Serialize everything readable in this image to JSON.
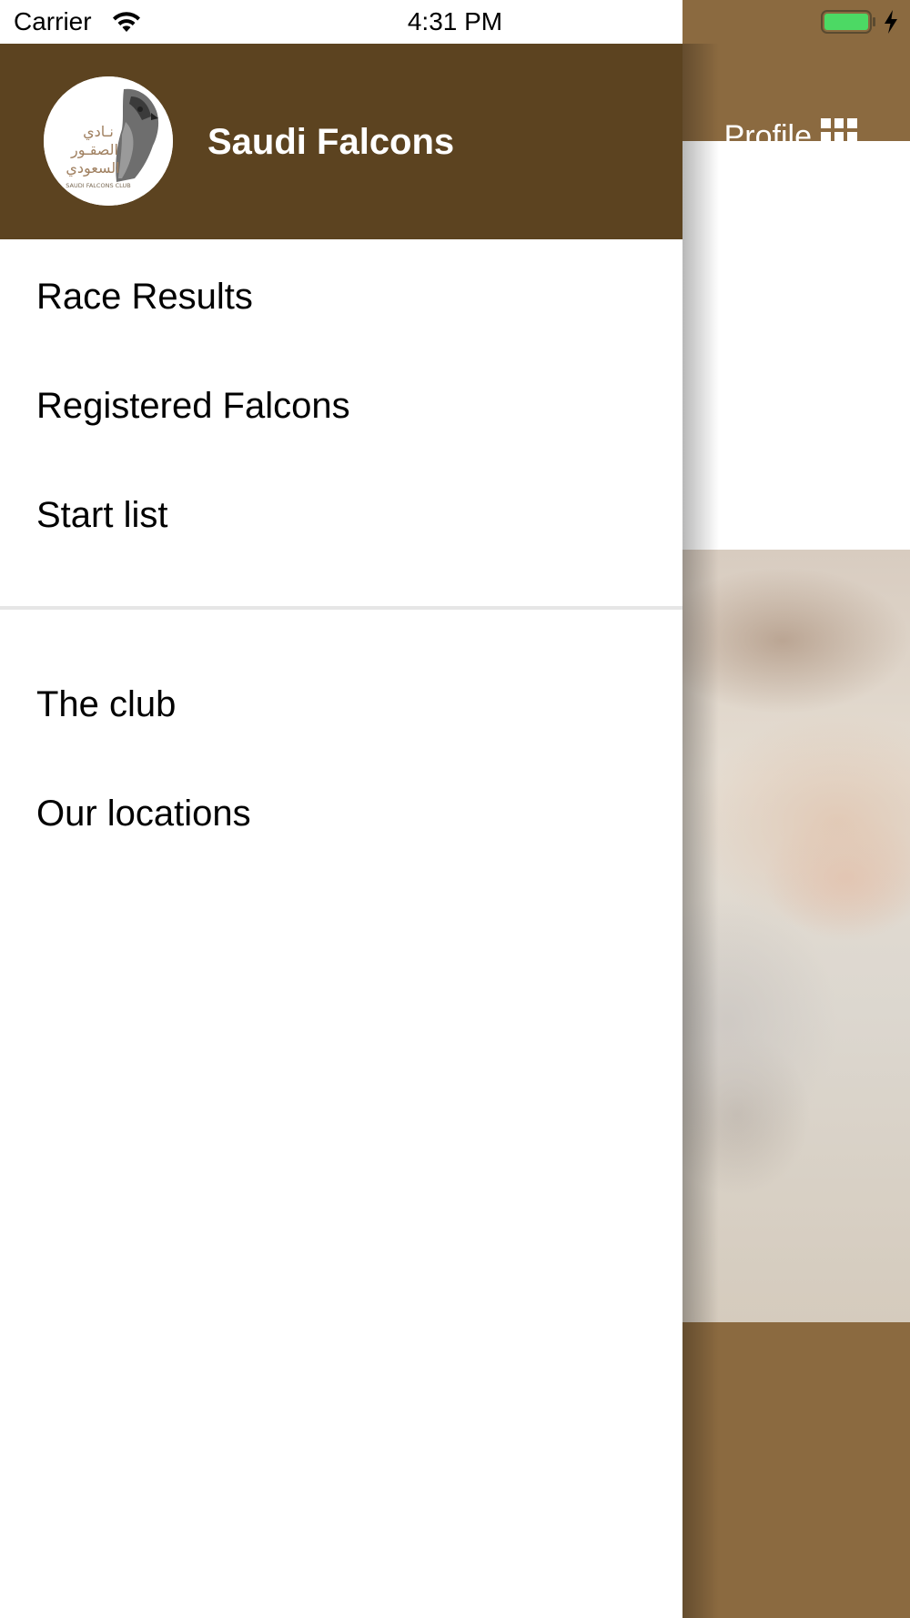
{
  "status_bar": {
    "carrier": "Carrier",
    "time": "4:31 PM",
    "wifi_icon": "wifi-icon",
    "battery_icon": "battery-icon",
    "charging_icon": "bolt-icon",
    "battery_color": "#4cd964"
  },
  "background_app": {
    "profile_label": "Profile",
    "profile_icon": "grid-icon",
    "accent_color": "#8b6a40"
  },
  "drawer": {
    "title": "Saudi Falcons",
    "header_color": "#5c4320",
    "logo": {
      "arabic_line1": "نـادي",
      "arabic_line2": "الصقـور",
      "arabic_line3": "السعودي",
      "english": "SAUDI FALCONS CLUB"
    },
    "primary_items": [
      {
        "label": "Race Results"
      },
      {
        "label": "Registered Falcons"
      },
      {
        "label": "Start list"
      }
    ],
    "secondary_items": [
      {
        "label": "The club"
      },
      {
        "label": "Our locations"
      }
    ]
  }
}
